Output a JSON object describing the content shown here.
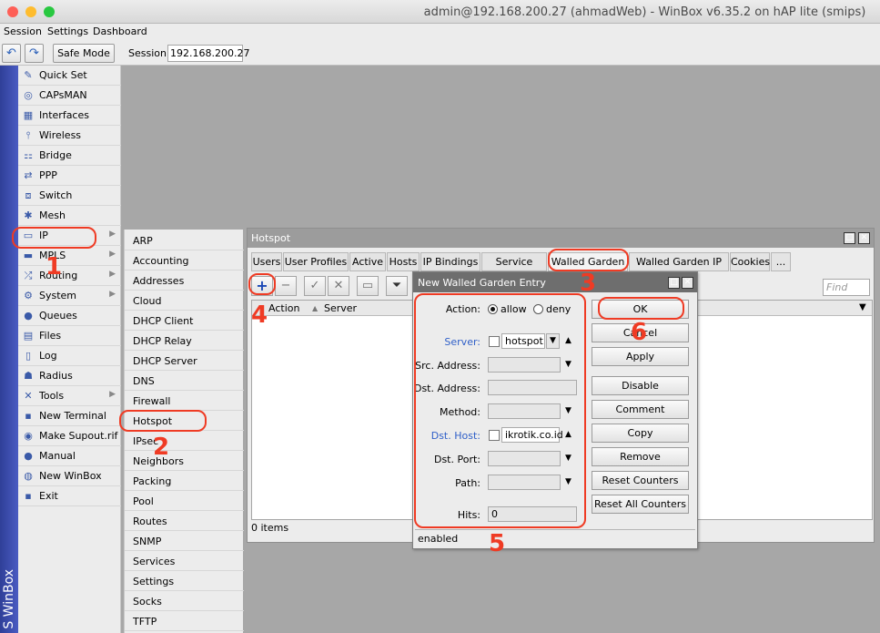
{
  "window": {
    "title": "admin@192.168.200.27 (ahmadWeb) - WinBox v6.35.2 on hAP lite (smips)",
    "controls": {
      "close_color": "#fe5f57",
      "minimize_color": "#febc2e",
      "zoom_color": "#28c840"
    }
  },
  "menubar": [
    "Session",
    "Settings",
    "Dashboard"
  ],
  "toolbar": {
    "undo_icon": "undo-icon",
    "redo_icon": "redo-icon",
    "safe_mode": "Safe Mode",
    "session_label": "Session:",
    "session_value": "192.168.200.27"
  },
  "brand": "S WinBox",
  "mainmenu": [
    {
      "label": "Quick Set",
      "icon": "quick-set-icon",
      "glyph": "✎"
    },
    {
      "label": "CAPsMAN",
      "icon": "capsman-icon",
      "glyph": "◎"
    },
    {
      "label": "Interfaces",
      "icon": "interfaces-icon",
      "glyph": "▦"
    },
    {
      "label": "Wireless",
      "icon": "wireless-icon",
      "glyph": "⫯"
    },
    {
      "label": "Bridge",
      "icon": "bridge-icon",
      "glyph": "⚏"
    },
    {
      "label": "PPP",
      "icon": "ppp-icon",
      "glyph": "⇄"
    },
    {
      "label": "Switch",
      "icon": "switch-icon",
      "glyph": "⧈"
    },
    {
      "label": "Mesh",
      "icon": "mesh-icon",
      "glyph": "✱"
    },
    {
      "label": "IP",
      "icon": "ip-icon",
      "glyph": "▭",
      "arrow": true
    },
    {
      "label": "MPLS",
      "icon": "mpls-icon",
      "glyph": "▬",
      "arrow": true
    },
    {
      "label": "Routing",
      "icon": "routing-icon",
      "glyph": "⤮",
      "arrow": true
    },
    {
      "label": "System",
      "icon": "system-icon",
      "glyph": "⚙",
      "arrow": true
    },
    {
      "label": "Queues",
      "icon": "queues-icon",
      "glyph": "●"
    },
    {
      "label": "Files",
      "icon": "files-icon",
      "glyph": "▤"
    },
    {
      "label": "Log",
      "icon": "log-icon",
      "glyph": "▯"
    },
    {
      "label": "Radius",
      "icon": "radius-icon",
      "glyph": "☗"
    },
    {
      "label": "Tools",
      "icon": "tools-icon",
      "glyph": "✕",
      "arrow": true
    },
    {
      "label": "New Terminal",
      "icon": "terminal-icon",
      "glyph": "▪"
    },
    {
      "label": "Make Supout.rif",
      "icon": "supout-icon",
      "glyph": "◉"
    },
    {
      "label": "Manual",
      "icon": "manual-icon",
      "glyph": "●"
    },
    {
      "label": "New WinBox",
      "icon": "winbox-icon",
      "glyph": "◍"
    },
    {
      "label": "Exit",
      "icon": "exit-icon",
      "glyph": "▪"
    }
  ],
  "ip_submenu": [
    "ARP",
    "Accounting",
    "Addresses",
    "Cloud",
    "DHCP Client",
    "DHCP Relay",
    "DHCP Server",
    "DNS",
    "Firewall",
    "Hotspot",
    "IPsec",
    "Neighbors",
    "Packing",
    "Pool",
    "Routes",
    "SNMP",
    "Services",
    "Settings",
    "Socks",
    "TFTP"
  ],
  "hotspot": {
    "title": "Hotspot",
    "tabs": [
      "Users",
      "User Profiles",
      "Active",
      "Hosts",
      "IP Bindings",
      "Service Ports",
      "Walled Garden",
      "Walled Garden IP List",
      "Cookies",
      "..."
    ],
    "active_tab": "Walled Garden",
    "find_placeholder": "Find",
    "columns": [
      "Action",
      "Server"
    ],
    "status": "0 items"
  },
  "dialog": {
    "title": "New Walled Garden Entry",
    "action_label": "Action:",
    "action_allow": "allow",
    "action_deny": "deny",
    "server_label": "Server:",
    "server_value": "hotspot",
    "src_address_label": "Src. Address:",
    "dst_address_label": "Dst. Address:",
    "method_label": "Method:",
    "dst_host_label": "Dst. Host:",
    "dst_host_value": "ikrotik.co.id",
    "dst_port_label": "Dst. Port:",
    "path_label": "Path:",
    "hits_label": "Hits:",
    "hits_value": "0",
    "buttons": [
      "OK",
      "Cancel",
      "Apply",
      "Disable",
      "Comment",
      "Copy",
      "Remove",
      "Reset Counters",
      "Reset All Counters"
    ],
    "status": "enabled"
  },
  "annotations": [
    "1",
    "2",
    "3",
    "4",
    "5",
    "6"
  ],
  "colors": {
    "annotation": "#ef3b24",
    "link_label": "#2f5fc8",
    "brand": "#3a4bb0"
  }
}
